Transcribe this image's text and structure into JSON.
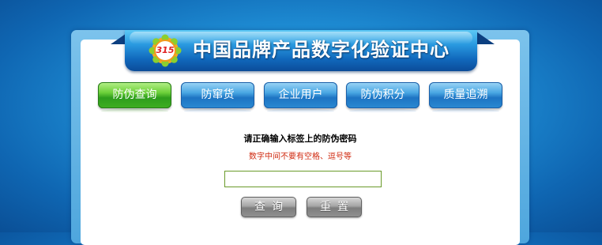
{
  "header": {
    "logo_text": "315",
    "title": "中国品牌产品数字化验证中心"
  },
  "tabs": [
    {
      "label": "防伪查询",
      "active": true
    },
    {
      "label": "防窜货",
      "active": false
    },
    {
      "label": "企业用户",
      "active": false
    },
    {
      "label": "防伪积分",
      "active": false
    },
    {
      "label": "质量追溯",
      "active": false
    }
  ],
  "form": {
    "prompt": "请正确输入标签上的防伪密码",
    "hint": "数字中间不要有空格、逗号等",
    "input_value": "",
    "query_label": "查询",
    "reset_label": "重置"
  },
  "colors": {
    "active_tab": "#3fae22",
    "tab": "#2b8ad2",
    "hint": "#d02a10",
    "input_border": "#6a9a2a"
  }
}
